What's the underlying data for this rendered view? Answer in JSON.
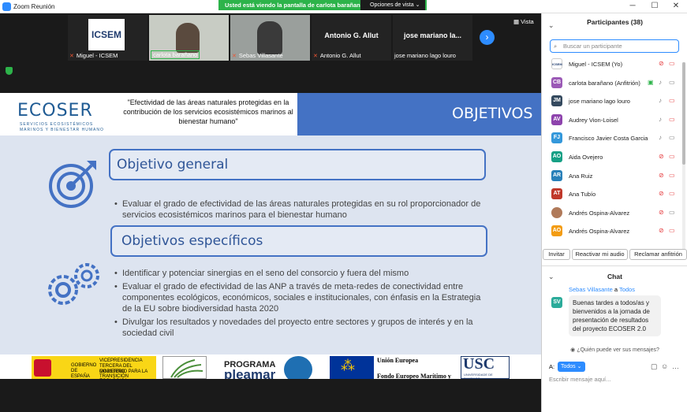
{
  "window": {
    "title": "Zoom Reunión",
    "minimize": "─",
    "maximize": "☐",
    "close": "✕"
  },
  "share_banner": {
    "text": "Usted está viendo la pantalla de carlota barañano",
    "view_options": "Opciones de vista"
  },
  "video_strip": {
    "view_label": "Vista",
    "tiles": [
      {
        "name": "Miguel - ICSEM",
        "muted": true,
        "logo": "ICSEM"
      },
      {
        "name": "carlota barañano",
        "muted": false
      },
      {
        "name": "Sebas Villasante",
        "muted": true
      },
      {
        "name": "Antonio G. Allut",
        "muted": true,
        "big_name": "Antonio G. Allut"
      },
      {
        "name": "jose mariano lago louro",
        "muted": false,
        "big_name": "jose mariano la..."
      }
    ]
  },
  "slide": {
    "logo": "ECOSER",
    "logo_sub": "SERVICIOS ECOSISTÉMICOS MARINOS Y BIENESTAR HUMANO",
    "subtitle": "\"Efectividad de las áreas naturales protegidas en la contribución de los servicios ecosistémicos marinos al bienestar humano\"",
    "title": "OBJETIVOS",
    "general_heading": "Objetivo general",
    "general_bullet": "Evaluar el grado de efectividad de las áreas naturales protegidas en su rol proporcionador de servicios ecosistémicos marinos para el bienestar humano",
    "specific_heading": "Objetivos específicos",
    "specific_bullets": [
      "Identificar y potenciar sinergias en el seno del consorcio y fuera del mismo",
      "Evaluar el grado de efectividad de las ANP a través de meta-redes de conectividad entre componentes ecológicos, económicos, sociales e institucionales, con énfasis en la Estrategia de la EU sobre biodiversidad hasta 2020",
      "Divulgar los resultados y novedades del proyecto entre sectores y grupos de interés y en la sociedad civil"
    ],
    "footer": {
      "gov1": "GOBIERNO DE ESPAÑA",
      "gov2": "VICEPRESIDENCIA TERCERA DEL GOBIERNO",
      "gov3": "MINISTERIO PARA LA TRANSICIÓN ECOLÓGICA",
      "programa": "PROGRAMA",
      "pleamar": "pleamar",
      "eu1": "Unión Europea",
      "eu2": "Fondo Europeo Marítimo y",
      "usc": "USC",
      "usc_sub": "UNIVERSIDADE DE SANTIAGO"
    }
  },
  "participants": {
    "header": "Participantes (38)",
    "search_placeholder": "Buscar un participante",
    "list": [
      {
        "initials": "ICSEM",
        "name": "Miguel - ICSEM (Yo)",
        "color": "#ffffff",
        "mic_muted": true,
        "video_off": true
      },
      {
        "initials": "CB",
        "name": "carlota barañano (Anfitrión)",
        "color": "#9b59b6",
        "mic_muted": false,
        "video_off": false,
        "sharing": true
      },
      {
        "initials": "JM",
        "name": "jose mariano lago louro",
        "color": "#34495e",
        "mic_muted": false,
        "video_off": true
      },
      {
        "initials": "AV",
        "name": "Audrey Vion-Loisel",
        "color": "#8e44ad",
        "mic_muted": false,
        "video_off": true
      },
      {
        "initials": "FJ",
        "name": "Francisco Javier Costa Garcia",
        "color": "#3498db",
        "mic_muted": false,
        "video_off": false
      },
      {
        "initials": "AO",
        "name": "Aida Ovejero",
        "color": "#16a085",
        "mic_muted": true,
        "video_off": true
      },
      {
        "initials": "AR",
        "name": "Ana Ruiz",
        "color": "#2980b9",
        "mic_muted": true,
        "video_off": true
      },
      {
        "initials": "AT",
        "name": "Ana Tubío",
        "color": "#c0392b",
        "mic_muted": true,
        "video_off": true
      },
      {
        "initials": "",
        "name": "Andrés Ospina-Alvarez",
        "color": "#b07a5a",
        "mic_muted": true,
        "video_off": false
      },
      {
        "initials": "AO",
        "name": "Andrés Ospina-Alvarez",
        "color": "#f39c12",
        "mic_muted": true,
        "video_off": true
      }
    ],
    "buttons": [
      "Invitar",
      "Reactivar mi audio",
      "Reclamar anfitrión"
    ]
  },
  "chat": {
    "header": "Chat",
    "from": "Sebas Villasante",
    "to_word": "a",
    "to": "Todos",
    "avatar": "SV",
    "message": "Buenas tardes a todos/as y bienvenidos a la jornada de presentación de resultados del proyecto ECOSER 2.0",
    "who_sees": "¿Quién puede ver sus mensajes?",
    "to_label": "A:",
    "to_select": "Todos",
    "input_placeholder": "Escribir mensaje aquí..."
  }
}
